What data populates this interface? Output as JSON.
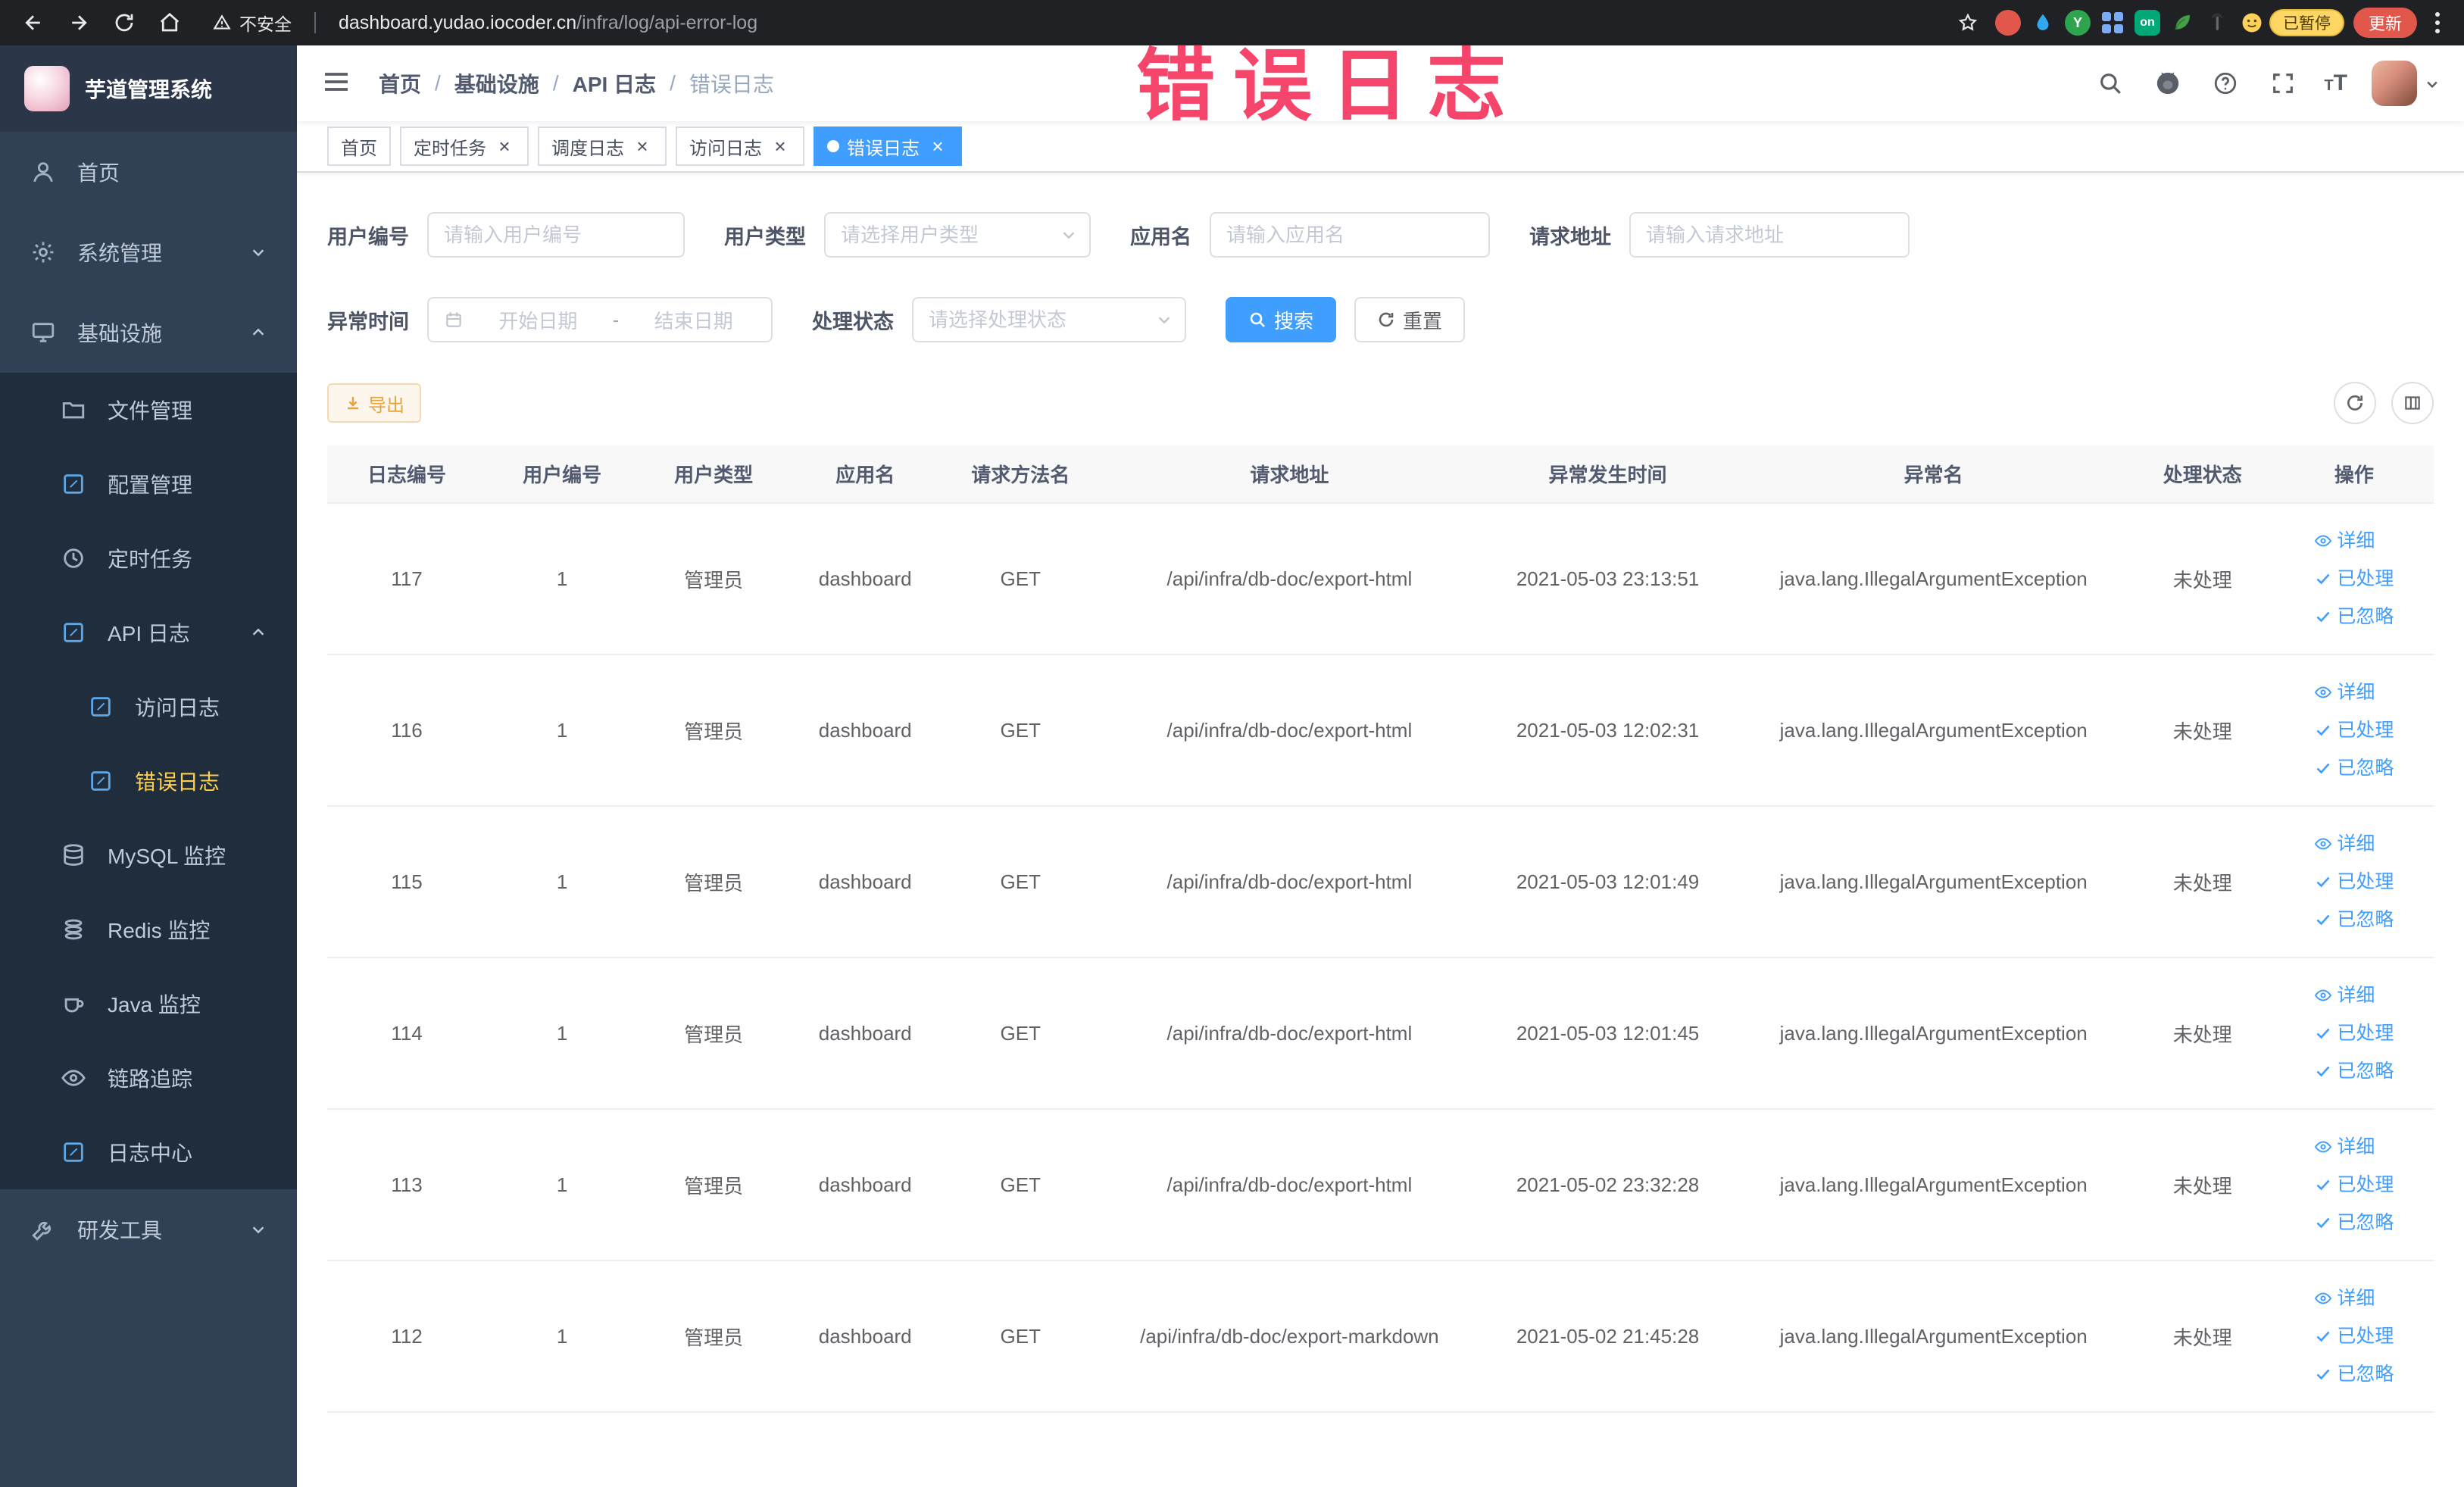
{
  "annotation": {
    "label": "错误日志"
  },
  "browser": {
    "security_text": "不安全",
    "url_host": "dashboard.yudao.iocoder.cn",
    "url_path": "/infra/log/api-error-log",
    "ext_y_label": "Y",
    "ext_on_label": "on",
    "paused_badge": "已暂停",
    "update_button": "更新"
  },
  "sidebar": {
    "title": "芋道管理系统",
    "items": {
      "home": "首页",
      "system": "系统管理",
      "infra": "基础设施",
      "file": "文件管理",
      "config": "配置管理",
      "job": "定时任务",
      "api_log": "API 日志",
      "access_log": "访问日志",
      "error_log": "错误日志",
      "mysql": "MySQL 监控",
      "redis": "Redis 监控",
      "java": "Java 监控",
      "trace": "链路追踪",
      "log_center": "日志中心",
      "dev_tools": "研发工具"
    }
  },
  "header": {
    "breadcrumb": {
      "home": "首页",
      "infra": "基础设施",
      "api_log": "API 日志",
      "current": "错误日志",
      "separator": "/"
    }
  },
  "tabs": [
    {
      "label": "首页"
    },
    {
      "label": "定时任务"
    },
    {
      "label": "调度日志"
    },
    {
      "label": "访问日志"
    },
    {
      "label": "错误日志"
    }
  ],
  "filters": {
    "user_id_label": "用户编号",
    "user_id_placeholder": "请输入用户编号",
    "user_type_label": "用户类型",
    "user_type_placeholder": "请选择用户类型",
    "app_name_label": "应用名",
    "app_name_placeholder": "请输入应用名",
    "request_url_label": "请求地址",
    "request_url_placeholder": "请输入请求地址",
    "exception_time_label": "异常时间",
    "start_date_placeholder": "开始日期",
    "range_separator": "-",
    "end_date_placeholder": "结束日期",
    "process_status_label": "处理状态",
    "process_status_placeholder": "请选择处理状态",
    "search_button": "搜索",
    "reset_button": "重置"
  },
  "toolbar": {
    "export_label": "导出"
  },
  "table": {
    "columns": [
      "日志编号",
      "用户编号",
      "用户类型",
      "应用名",
      "请求方法名",
      "请求地址",
      "异常发生时间",
      "异常名",
      "处理状态",
      "操作"
    ],
    "row_actions": {
      "detail": "详细",
      "processed": "已处理",
      "ignored": "已忽略"
    },
    "rows": [
      {
        "id": "117",
        "user_id": "1",
        "user_type": "管理员",
        "app_name": "dashboard",
        "method": "GET",
        "url": "/api/infra/db-doc/export-html",
        "time": "2021-05-03 23:13:51",
        "exception": "java.lang.IllegalArgumentException",
        "status": "未处理"
      },
      {
        "id": "116",
        "user_id": "1",
        "user_type": "管理员",
        "app_name": "dashboard",
        "method": "GET",
        "url": "/api/infra/db-doc/export-html",
        "time": "2021-05-03 12:02:31",
        "exception": "java.lang.IllegalArgumentException",
        "status": "未处理"
      },
      {
        "id": "115",
        "user_id": "1",
        "user_type": "管理员",
        "app_name": "dashboard",
        "method": "GET",
        "url": "/api/infra/db-doc/export-html",
        "time": "2021-05-03 12:01:49",
        "exception": "java.lang.IllegalArgumentException",
        "status": "未处理"
      },
      {
        "id": "114",
        "user_id": "1",
        "user_type": "管理员",
        "app_name": "dashboard",
        "method": "GET",
        "url": "/api/infra/db-doc/export-html",
        "time": "2021-05-03 12:01:45",
        "exception": "java.lang.IllegalArgumentException",
        "status": "未处理"
      },
      {
        "id": "113",
        "user_id": "1",
        "user_type": "管理员",
        "app_name": "dashboard",
        "method": "GET",
        "url": "/api/infra/db-doc/export-html",
        "time": "2021-05-02 23:32:28",
        "exception": "java.lang.IllegalArgumentException",
        "status": "未处理"
      },
      {
        "id": "112",
        "user_id": "1",
        "user_type": "管理员",
        "app_name": "dashboard",
        "method": "GET",
        "url": "/api/infra/db-doc/export-markdown",
        "time": "2021-05-02 21:45:28",
        "exception": "java.lang.IllegalArgumentException",
        "status": "未处理"
      }
    ]
  }
}
